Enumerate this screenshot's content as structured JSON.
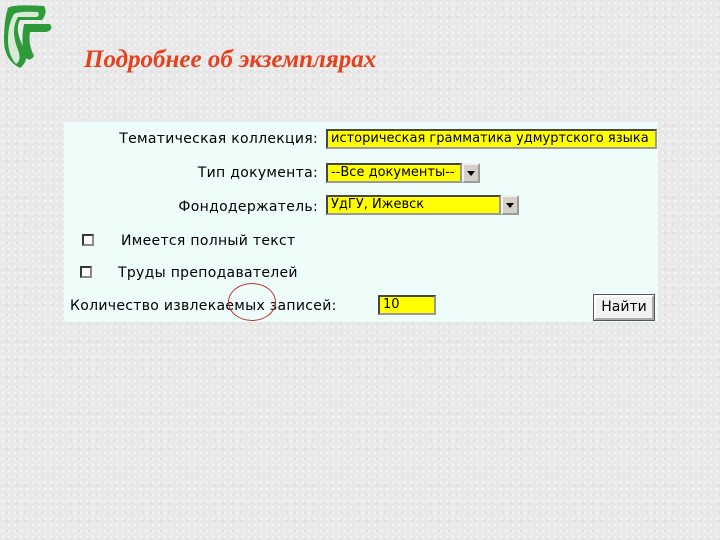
{
  "slide": {
    "title": "Подробнее об экземплярах"
  },
  "form": {
    "collection_label": "Тематическая коллекция:",
    "collection_value": "историческая грамматика удмуртского языка",
    "doctype_label": "Тип документа:",
    "doctype_value": "--Все документы--",
    "holder_label": "Фондодержатель:",
    "holder_value": "УдГУ, Ижевск",
    "fulltext_label": "Имеется полный текст",
    "fulltext_checked": false,
    "teachers_label": "Труды преподавателей",
    "teachers_checked": false,
    "count_label": "Количество извлекаемых записей:",
    "count_value": "10",
    "find_label": "Найти"
  },
  "colors": {
    "title": "#e8401c",
    "field": "#ffff00",
    "panel": "#eefdfa",
    "highlight_circle": "#c0312b",
    "logo": "#2e9a3a"
  }
}
